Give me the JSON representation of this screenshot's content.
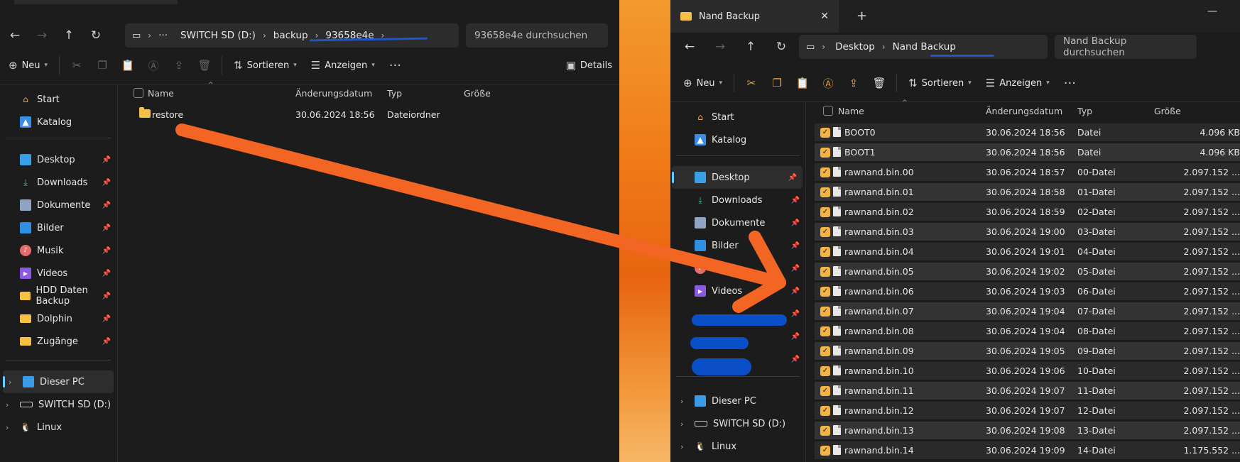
{
  "left": {
    "tab_title": "93658e4e",
    "breadcrumb": [
      "SWITCH SD (D:)",
      "backup",
      "93658e4e"
    ],
    "search_placeholder": "93658e4e durchsuchen",
    "toolbar": {
      "new": "Neu",
      "sort": "Sortieren",
      "view": "Anzeigen",
      "details": "Details"
    },
    "sidebar_top": [
      "Start",
      "Katalog"
    ],
    "sidebar_quick": [
      "Desktop",
      "Downloads",
      "Dokumente",
      "Bilder",
      "Musik",
      "Videos",
      "HDD Daten Backup",
      "Dolphin",
      "Zugänge"
    ],
    "sidebar_drives": [
      "Dieser PC",
      "SWITCH SD (D:)",
      "Linux"
    ],
    "columns": [
      "Name",
      "Änderungsdatum",
      "Typ",
      "Größe"
    ],
    "files": [
      {
        "name": "restore",
        "date": "30.06.2024 18:56",
        "type": "Dateiordner",
        "size": ""
      }
    ]
  },
  "right": {
    "tab_title": "Nand Backup",
    "breadcrumb": [
      "Desktop",
      "Nand Backup"
    ],
    "search_placeholder": "Nand Backup durchsuchen",
    "toolbar": {
      "new": "Neu",
      "sort": "Sortieren",
      "view": "Anzeigen"
    },
    "sidebar_top": [
      "Start",
      "Katalog"
    ],
    "sidebar_quick": [
      "Desktop",
      "Downloads",
      "Dokumente",
      "Bilder",
      "Musik",
      "Videos"
    ],
    "sidebar_drives": [
      "Dieser PC",
      "SWITCH SD (D:)",
      "Linux"
    ],
    "columns": [
      "Name",
      "Änderungsdatum",
      "Typ",
      "Größe"
    ],
    "files": [
      {
        "name": "BOOT0",
        "date": "30.06.2024 18:56",
        "type": "Datei",
        "size": "4.096 KB"
      },
      {
        "name": "BOOT1",
        "date": "30.06.2024 18:56",
        "type": "Datei",
        "size": "4.096 KB"
      },
      {
        "name": "rawnand.bin.00",
        "date": "30.06.2024 18:57",
        "type": "00-Datei",
        "size": "2.097.152 ..."
      },
      {
        "name": "rawnand.bin.01",
        "date": "30.06.2024 18:58",
        "type": "01-Datei",
        "size": "2.097.152 ..."
      },
      {
        "name": "rawnand.bin.02",
        "date": "30.06.2024 18:59",
        "type": "02-Datei",
        "size": "2.097.152 ..."
      },
      {
        "name": "rawnand.bin.03",
        "date": "30.06.2024 19:00",
        "type": "03-Datei",
        "size": "2.097.152 ..."
      },
      {
        "name": "rawnand.bin.04",
        "date": "30.06.2024 19:01",
        "type": "04-Datei",
        "size": "2.097.152 ..."
      },
      {
        "name": "rawnand.bin.05",
        "date": "30.06.2024 19:02",
        "type": "05-Datei",
        "size": "2.097.152 ..."
      },
      {
        "name": "rawnand.bin.06",
        "date": "30.06.2024 19:03",
        "type": "06-Datei",
        "size": "2.097.152 ..."
      },
      {
        "name": "rawnand.bin.07",
        "date": "30.06.2024 19:04",
        "type": "07-Datei",
        "size": "2.097.152 ..."
      },
      {
        "name": "rawnand.bin.08",
        "date": "30.06.2024 19:04",
        "type": "08-Datei",
        "size": "2.097.152 ..."
      },
      {
        "name": "rawnand.bin.09",
        "date": "30.06.2024 19:05",
        "type": "09-Datei",
        "size": "2.097.152 ..."
      },
      {
        "name": "rawnand.bin.10",
        "date": "30.06.2024 19:06",
        "type": "10-Datei",
        "size": "2.097.152 ..."
      },
      {
        "name": "rawnand.bin.11",
        "date": "30.06.2024 19:07",
        "type": "11-Datei",
        "size": "2.097.152 ..."
      },
      {
        "name": "rawnand.bin.12",
        "date": "30.06.2024 19:07",
        "type": "12-Datei",
        "size": "2.097.152 ..."
      },
      {
        "name": "rawnand.bin.13",
        "date": "30.06.2024 19:08",
        "type": "13-Datei",
        "size": "2.097.152 ..."
      },
      {
        "name": "rawnand.bin.14",
        "date": "30.06.2024 19:09",
        "type": "14-Datei",
        "size": "1.175.552 ..."
      }
    ]
  },
  "colors": {
    "accent": "#60cdff",
    "check": "#f3b443",
    "annotation_arrow": "#f26522",
    "annotation_ink": "#0a4fc8"
  }
}
